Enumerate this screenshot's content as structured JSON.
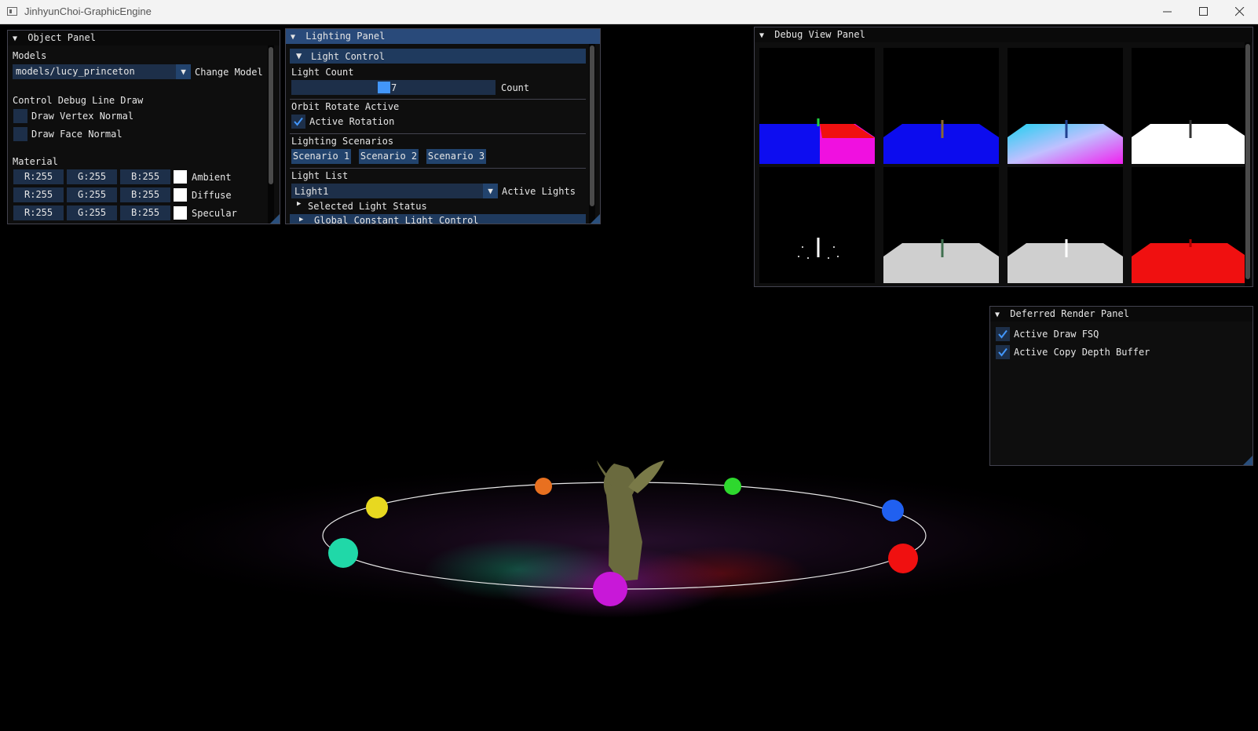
{
  "window": {
    "title": "JinhyunChoi-GraphicEngine"
  },
  "object_panel": {
    "title": "Object Panel",
    "models_label": "Models",
    "model_value": "models/lucy_princeton",
    "change_model_label": "Change Model",
    "debug_line_label": "Control Debug Line Draw",
    "draw_vertex_normal": "Draw Vertex Normal",
    "draw_face_normal": "Draw Face Normal",
    "material_label": "Material",
    "materials": [
      {
        "r": "R:255",
        "g": "G:255",
        "b": "B:255",
        "name": "Ambient"
      },
      {
        "r": "R:255",
        "g": "G:255",
        "b": "B:255",
        "name": "Diffuse"
      },
      {
        "r": "R:255",
        "g": "G:255",
        "b": "B:255",
        "name": "Specular"
      }
    ]
  },
  "lighting_panel": {
    "title": "Lighting Panel",
    "light_control": "Light Control",
    "light_count_label": "Light Count",
    "light_count_value": "7",
    "light_count_fraction": 0.45,
    "count_label": "Count",
    "orbit_label": "Orbit Rotate Active",
    "active_rotation": "Active Rotation",
    "scenarios_label": "Lighting Scenarios",
    "scenarios": [
      "Scenario 1",
      "Scenario 2",
      "Scenario 3"
    ],
    "light_list_label": "Light List",
    "light_list_value": "Light1",
    "active_lights_label": "Active Lights",
    "selected_status": "Selected Light Status",
    "global_control": "Global Constant Light Control"
  },
  "debug_panel": {
    "title": "Debug View Panel"
  },
  "deferred_panel": {
    "title": "Deferred Render Panel",
    "draw_fsq": "Active Draw FSQ",
    "copy_depth": "Active Copy Depth Buffer"
  },
  "scene": {
    "light_colors": [
      "#e87020",
      "#2ed82e",
      "#2060f0",
      "#f01010",
      "#c818d8",
      "#20d8a8",
      "#e8d820"
    ]
  },
  "colors": {
    "accent": "#4296fa",
    "title_active": "#294a7a",
    "frame_bg": "#1d2f49",
    "button_bg": "#22436d"
  }
}
